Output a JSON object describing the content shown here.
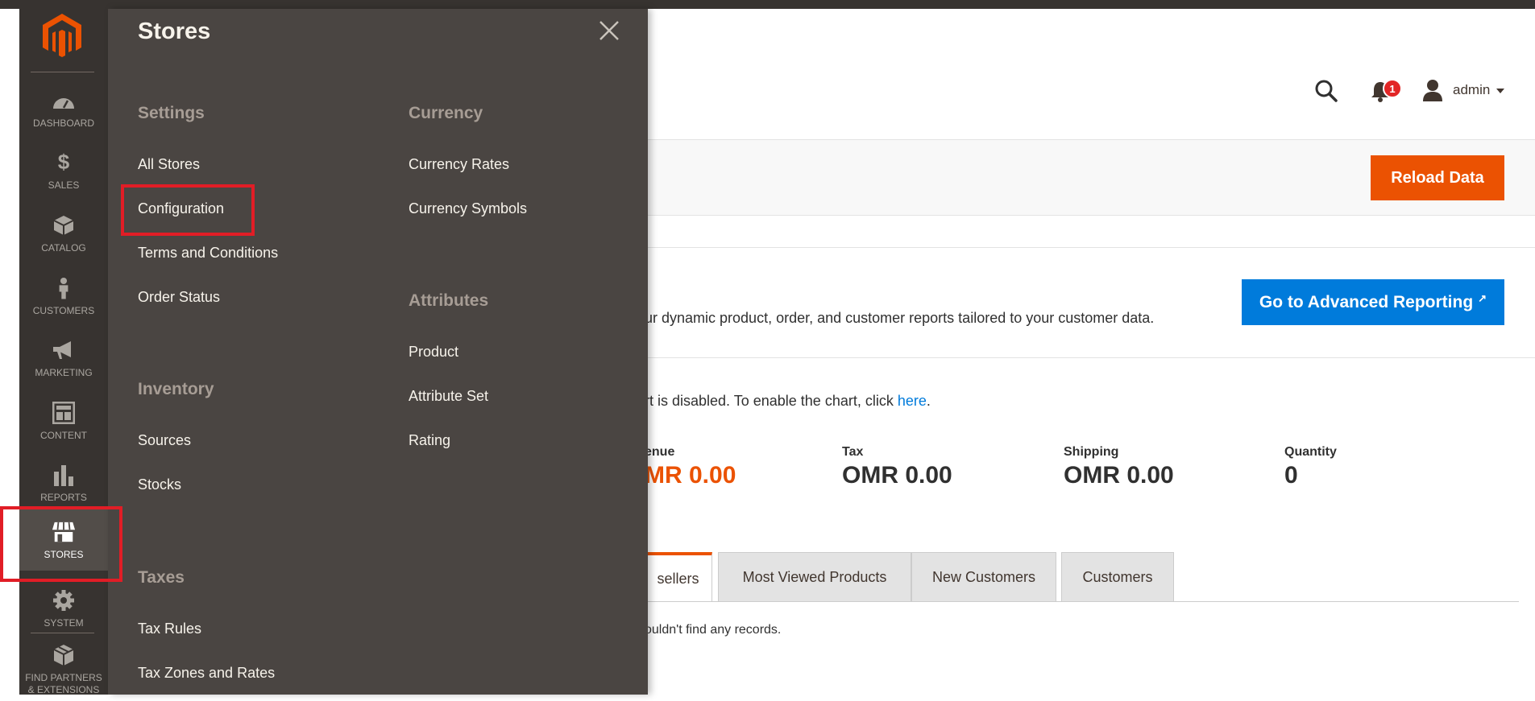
{
  "header": {
    "user_name": "admin",
    "notification_count": "1",
    "icons": [
      "search-icon",
      "bell-icon",
      "user-icon",
      "caret-down-icon"
    ]
  },
  "dashboard": {
    "reload_button": "Reload Data",
    "advanced_text": "ur dynamic product, order, and customer reports tailored to your customer data.",
    "advanced_button": "Go to Advanced Reporting",
    "chart_note": "rt is disabled. To enable the chart, click ",
    "chart_link": "here",
    "chart_note_end": ".",
    "totals": [
      {
        "label": "enue",
        "value": "MR 0.00"
      },
      {
        "label": "Tax",
        "value": "OMR 0.00"
      },
      {
        "label": "Shipping",
        "value": "OMR 0.00"
      },
      {
        "label": "Quantity",
        "value": "0"
      }
    ],
    "tabs": [
      "sellers",
      "Most Viewed Products",
      "New Customers",
      "Customers"
    ],
    "no_records": "ouldn't find any records."
  },
  "nav": {
    "items": [
      {
        "label": "DASHBOARD",
        "icon": "dashboard-icon"
      },
      {
        "label": "SALES",
        "icon": "dollar-icon"
      },
      {
        "label": "CATALOG",
        "icon": "box-icon"
      },
      {
        "label": "CUSTOMERS",
        "icon": "person-icon"
      },
      {
        "label": "MARKETING",
        "icon": "megaphone-icon"
      },
      {
        "label": "CONTENT",
        "icon": "layout-icon"
      },
      {
        "label": "REPORTS",
        "icon": "bar-chart-icon"
      },
      {
        "label": "STORES",
        "icon": "store-icon"
      },
      {
        "label": "SYSTEM",
        "icon": "gear-icon"
      },
      {
        "label": "FIND PARTNERS & EXTENSIONS",
        "icon": "cubes-icon"
      }
    ],
    "active": "STORES"
  },
  "flyout": {
    "title": "Stores",
    "sections": {
      "settings": {
        "title": "Settings",
        "links": [
          "All Stores",
          "Configuration",
          "Terms and Conditions",
          "Order Status"
        ]
      },
      "inventory": {
        "title": "Inventory",
        "links": [
          "Sources",
          "Stocks"
        ]
      },
      "taxes": {
        "title": "Taxes",
        "links": [
          "Tax Rules",
          "Tax Zones and Rates"
        ]
      },
      "currency": {
        "title": "Currency",
        "links": [
          "Currency Rates",
          "Currency Symbols"
        ]
      },
      "attributes": {
        "title": "Attributes",
        "links": [
          "Product",
          "Attribute Set",
          "Rating"
        ]
      }
    }
  },
  "colors": {
    "nav_bg": "#373330",
    "flyout_bg": "#4a4542",
    "accent_orange": "#eb5202",
    "accent_blue": "#007bdb",
    "highlight_red": "#e11d26"
  }
}
